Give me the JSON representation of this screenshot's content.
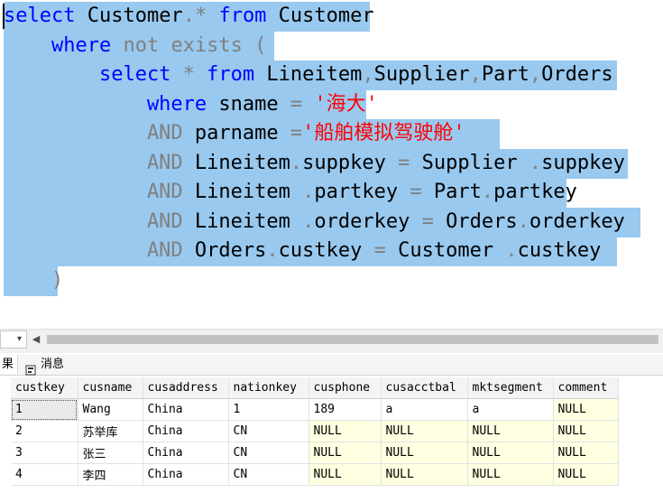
{
  "editor": {
    "lines": [
      [
        {
          "t": "select",
          "c": "kw"
        },
        {
          "t": " Customer",
          "c": "tx"
        },
        {
          "t": ".",
          "c": "gr"
        },
        {
          "t": "*",
          "c": "gr"
        },
        {
          "t": " from",
          "c": "kw"
        },
        {
          "t": " Customer",
          "c": "tx"
        }
      ],
      [
        {
          "t": "    where",
          "c": "kw"
        },
        {
          "t": " not exists (",
          "c": "gr"
        }
      ],
      [
        {
          "t": "        select",
          "c": "kw"
        },
        {
          "t": " *",
          "c": "gr"
        },
        {
          "t": " from",
          "c": "kw"
        },
        {
          "t": " Lineitem",
          "c": "tx"
        },
        {
          "t": ",",
          "c": "gr"
        },
        {
          "t": "Supplier",
          "c": "tx"
        },
        {
          "t": ",",
          "c": "gr"
        },
        {
          "t": "Part",
          "c": "tx"
        },
        {
          "t": ",",
          "c": "gr"
        },
        {
          "t": "Orders",
          "c": "tx"
        }
      ],
      [
        {
          "t": "            where",
          "c": "kw"
        },
        {
          "t": " sname",
          "c": "tx"
        },
        {
          "t": " =",
          "c": "gr"
        },
        {
          "t": " '海大'",
          "c": "st"
        }
      ],
      [
        {
          "t": "            AND",
          "c": "gr"
        },
        {
          "t": " parname",
          "c": "tx"
        },
        {
          "t": " =",
          "c": "gr"
        },
        {
          "t": "'船舶模拟驾驶舱'",
          "c": "st"
        }
      ],
      [
        {
          "t": "            AND",
          "c": "gr"
        },
        {
          "t": " Lineitem",
          "c": "tx"
        },
        {
          "t": ".",
          "c": "gr"
        },
        {
          "t": "suppkey",
          "c": "tx"
        },
        {
          "t": " =",
          "c": "gr"
        },
        {
          "t": " Supplier",
          "c": "tx"
        },
        {
          "t": " .",
          "c": "gr"
        },
        {
          "t": "suppkey",
          "c": "tx"
        }
      ],
      [
        {
          "t": "            AND",
          "c": "gr"
        },
        {
          "t": " Lineitem",
          "c": "tx"
        },
        {
          "t": " .",
          "c": "gr"
        },
        {
          "t": "partkey",
          "c": "tx"
        },
        {
          "t": " =",
          "c": "gr"
        },
        {
          "t": " Part",
          "c": "tx"
        },
        {
          "t": ".",
          "c": "gr"
        },
        {
          "t": "partkey",
          "c": "tx"
        }
      ],
      [
        {
          "t": "            AND",
          "c": "gr"
        },
        {
          "t": " Lineitem",
          "c": "tx"
        },
        {
          "t": " .",
          "c": "gr"
        },
        {
          "t": "orderkey",
          "c": "tx"
        },
        {
          "t": " =",
          "c": "gr"
        },
        {
          "t": " Orders",
          "c": "tx"
        },
        {
          "t": ".",
          "c": "gr"
        },
        {
          "t": "orderkey",
          "c": "tx"
        }
      ],
      [
        {
          "t": "            AND",
          "c": "gr"
        },
        {
          "t": " Orders",
          "c": "tx"
        },
        {
          "t": ".",
          "c": "gr"
        },
        {
          "t": "custkey",
          "c": "tx"
        },
        {
          "t": " =",
          "c": "gr"
        },
        {
          "t": " Customer",
          "c": "tx"
        },
        {
          "t": " .",
          "c": "gr"
        },
        {
          "t": "custkey",
          "c": "tx"
        }
      ],
      [
        {
          "t": "    )",
          "c": "gr"
        }
      ]
    ]
  },
  "tabs": {
    "results": "果",
    "messages": "消息"
  },
  "grid": {
    "columns": [
      "custkey",
      "cusname",
      "cusaddress",
      "nationkey",
      "cusphone",
      "cusacctbal",
      "mktsegment",
      "comment"
    ],
    "rows": [
      [
        "1",
        "Wang",
        "China",
        "1",
        "189",
        "a",
        "a",
        "NULL"
      ],
      [
        "2",
        "苏举库",
        "China",
        "CN",
        "NULL",
        "NULL",
        "NULL",
        "NULL"
      ],
      [
        "3",
        "张三",
        "China",
        "CN",
        "NULL",
        "NULL",
        "NULL",
        "NULL"
      ],
      [
        "4",
        "李四",
        "China",
        "CN",
        "NULL",
        "NULL",
        "NULL",
        "NULL"
      ]
    ]
  },
  "colors": {
    "selection": "#99c9ef",
    "keyword": "#0000ff",
    "string": "#ff0000",
    "operator": "#808080",
    "null_cell": "#ffffe1"
  }
}
